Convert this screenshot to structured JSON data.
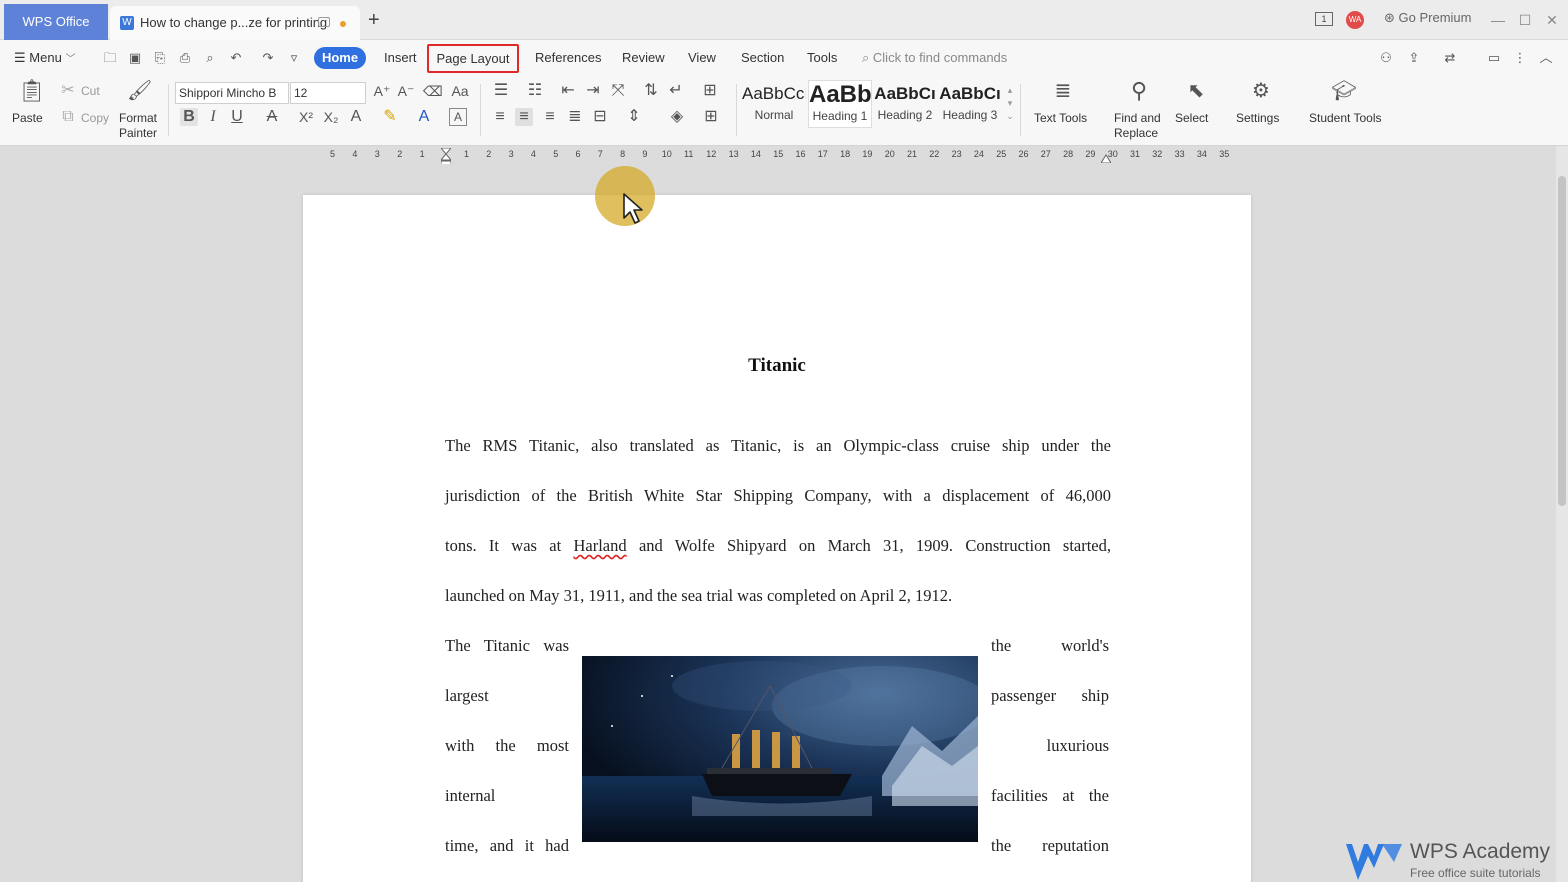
{
  "titlebar": {
    "app_tab": "WPS Office",
    "doc_tab": "How to change p...ze for printing",
    "doc_icon": "W",
    "new_tab": "+",
    "avatar": "WA",
    "layout_indicator": "1",
    "go_premium": "Go Premium"
  },
  "menubar": {
    "menu_label": "Menu",
    "tabs": [
      "Home",
      "Insert",
      "Page Layout",
      "References",
      "Review",
      "View",
      "Section",
      "Tools"
    ],
    "active_tab": "Home",
    "highlighted_tab": "Page Layout",
    "search_placeholder": "Click to find commands"
  },
  "ribbon": {
    "clipboard": {
      "paste": "Paste",
      "cut": "Cut",
      "copy": "Copy",
      "format_painter_line1": "Format",
      "format_painter_line2": "Painter"
    },
    "font": {
      "family": "Shippori Mincho B",
      "size": "12"
    },
    "styles": [
      {
        "sample": "AaBbCcI",
        "name": "Normal"
      },
      {
        "sample": "AaBb",
        "name": "Heading 1"
      },
      {
        "sample": "AaBbCı",
        "name": "Heading 2"
      },
      {
        "sample": "AaBbCı",
        "name": "Heading 3"
      }
    ],
    "text_tools": "Text Tools",
    "find_replace_line1": "Find and",
    "find_replace_line2": "Replace",
    "select": "Select",
    "settings": "Settings",
    "student_tools": "Student Tools"
  },
  "ruler": {
    "left_numbers": [
      "5",
      "4",
      "3",
      "2",
      "1"
    ],
    "right_numbers": [
      "1",
      "2",
      "3",
      "4",
      "5",
      "6",
      "7",
      "8",
      "9",
      "10",
      "11",
      "12",
      "13",
      "14",
      "15",
      "16",
      "17",
      "18",
      "19",
      "20",
      "21",
      "22",
      "23",
      "24",
      "25",
      "26",
      "27",
      "28",
      "29",
      "30",
      "31",
      "32",
      "33",
      "34",
      "35"
    ]
  },
  "document": {
    "title": "Titanic",
    "lines": [
      "The RMS Titanic, also translated as Titanic, is an Olympic-class cruise ship under the",
      "jurisdiction of the British White Star Shipping Company, with a displacement of 46,000",
      "launched on May 31, 1911, and the sea trial was completed on April 2, 1912."
    ],
    "line3_part1": "tons. It was at ",
    "line3_squiggle": "Harland",
    "line3_part2": " and Wolfe Shipyard on March 31, 1909. Construction started,",
    "wrap_left": [
      "The Titanic was",
      "largest",
      "with the most",
      "internal",
      "time, and it had"
    ],
    "wrap_right": [
      "the world's",
      "passenger ship",
      "luxurious",
      "facilities at the",
      "the reputation"
    ]
  },
  "watermark": {
    "title": "WPS Academy",
    "subtitle": "Free office suite tutorials"
  }
}
